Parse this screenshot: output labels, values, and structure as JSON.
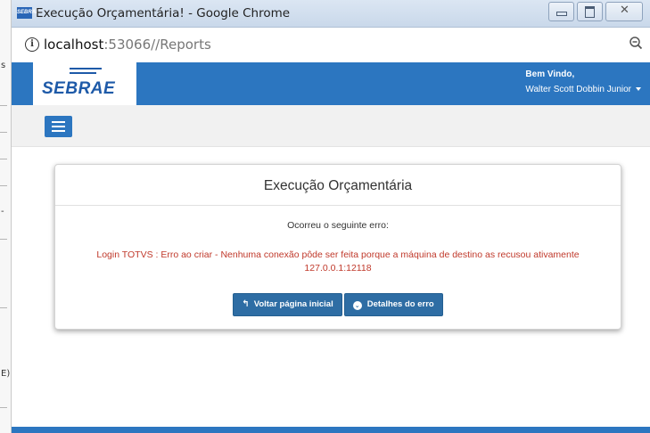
{
  "window": {
    "title": "Execução Orçamentária! - Google Chrome",
    "favicon_text": "SEBRAE"
  },
  "address_bar": {
    "host": "localhost",
    "rest": ":53066//Reports"
  },
  "behind_window": {
    "glyph_s": "s",
    "glyph_dash": "-",
    "glyph_e": "E)"
  },
  "header": {
    "logo": "SEBRAE",
    "welcome": "Bem Vindo,",
    "user_name": "Walter Scott Dobbin Junior"
  },
  "card": {
    "title": "Execução Orçamentária",
    "message": "Ocorreu o seguinte erro:",
    "error": "Login TOTVS : Erro ao criar - Nenhuma conexão pôde ser feita porque a máquina de destino as recusou ativamente 127.0.0.1:12118",
    "back_button": "Voltar página inicial",
    "details_button": "Detalhes do erro"
  },
  "colors": {
    "primary": "#2c76c0",
    "button": "#2e6da4",
    "error": "#c0392b"
  },
  "icons": [
    "info-icon",
    "zoom-icon",
    "menu-icon",
    "reply-icon",
    "chevron-circle-icon",
    "caret-down-icon"
  ]
}
